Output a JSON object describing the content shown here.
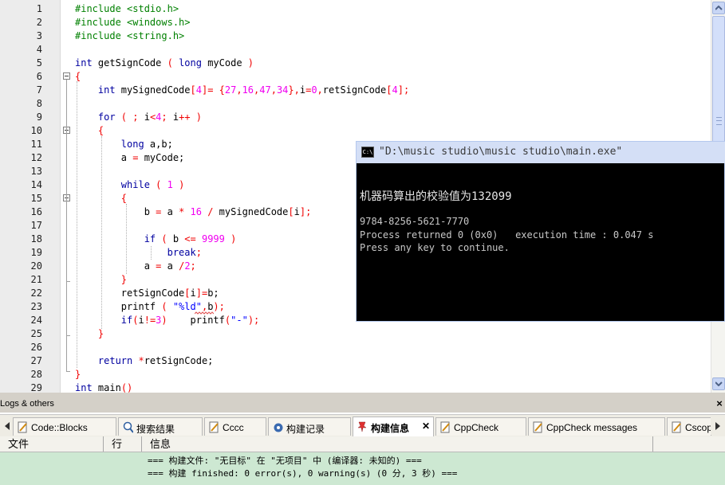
{
  "editor": {
    "line_numbers": [
      "1",
      "2",
      "3",
      "4",
      "5",
      "6",
      "7",
      "8",
      "9",
      "10",
      "11",
      "12",
      "13",
      "14",
      "15",
      "16",
      "17",
      "18",
      "19",
      "20",
      "21",
      "22",
      "23",
      "24",
      "25",
      "26",
      "27",
      "28",
      "29"
    ],
    "lines": [
      [
        {
          "t": "#include <stdio.h>",
          "c": "pp"
        }
      ],
      [
        {
          "t": "#include <windows.h>",
          "c": "pp"
        }
      ],
      [
        {
          "t": "#include <string.h>",
          "c": "pp"
        }
      ],
      [],
      [
        {
          "t": "int",
          "c": "kw"
        },
        {
          "t": " getSignCode ",
          "c": "id"
        },
        {
          "t": "(",
          "c": "op"
        },
        {
          "t": " long",
          "c": "kw"
        },
        {
          "t": " myCode ",
          "c": "id"
        },
        {
          "t": ")",
          "c": "op"
        }
      ],
      [
        {
          "t": "{",
          "c": "op"
        }
      ],
      [
        {
          "t": "    int",
          "c": "kw"
        },
        {
          "t": " mySignedCode",
          "c": "id"
        },
        {
          "t": "[",
          "c": "op"
        },
        {
          "t": "4",
          "c": "num"
        },
        {
          "t": "]= {",
          "c": "op"
        },
        {
          "t": "27",
          "c": "num"
        },
        {
          "t": ",",
          "c": "op"
        },
        {
          "t": "16",
          "c": "num"
        },
        {
          "t": ",",
          "c": "op"
        },
        {
          "t": "47",
          "c": "num"
        },
        {
          "t": ",",
          "c": "op"
        },
        {
          "t": "34",
          "c": "num"
        },
        {
          "t": "},",
          "c": "op"
        },
        {
          "t": "i",
          "c": "id"
        },
        {
          "t": "=",
          "c": "op"
        },
        {
          "t": "0",
          "c": "num"
        },
        {
          "t": ",",
          "c": "op"
        },
        {
          "t": "retSignCode",
          "c": "id"
        },
        {
          "t": "[",
          "c": "op"
        },
        {
          "t": "4",
          "c": "num"
        },
        {
          "t": "];",
          "c": "op"
        }
      ],
      [],
      [
        {
          "t": "    for",
          "c": "kw"
        },
        {
          "t": " ( ; ",
          "c": "op"
        },
        {
          "t": "i",
          "c": "id"
        },
        {
          "t": "<",
          "c": "op"
        },
        {
          "t": "4",
          "c": "num"
        },
        {
          "t": "; ",
          "c": "op"
        },
        {
          "t": "i",
          "c": "id"
        },
        {
          "t": "++ )",
          "c": "op"
        }
      ],
      [
        {
          "t": "    {",
          "c": "op"
        }
      ],
      [
        {
          "t": "        long",
          "c": "kw"
        },
        {
          "t": " a,b;",
          "c": "id"
        }
      ],
      [
        {
          "t": "        a ",
          "c": "id"
        },
        {
          "t": "=",
          "c": "op"
        },
        {
          "t": " myCode;",
          "c": "id"
        }
      ],
      [],
      [
        {
          "t": "        while",
          "c": "kw"
        },
        {
          "t": " ( ",
          "c": "op"
        },
        {
          "t": "1",
          "c": "num"
        },
        {
          "t": " )",
          "c": "op"
        }
      ],
      [
        {
          "t": "        {",
          "c": "op"
        }
      ],
      [
        {
          "t": "            b ",
          "c": "id"
        },
        {
          "t": "=",
          "c": "op"
        },
        {
          "t": " a ",
          "c": "id"
        },
        {
          "t": "*",
          "c": "op"
        },
        {
          "t": " 16 ",
          "c": "num"
        },
        {
          "t": "/",
          "c": "op"
        },
        {
          "t": " mySignedCode",
          "c": "id"
        },
        {
          "t": "[",
          "c": "op"
        },
        {
          "t": "i",
          "c": "id"
        },
        {
          "t": "];",
          "c": "op"
        }
      ],
      [],
      [
        {
          "t": "            if",
          "c": "kw"
        },
        {
          "t": " ( ",
          "c": "op"
        },
        {
          "t": "b ",
          "c": "id"
        },
        {
          "t": "<=",
          "c": "op"
        },
        {
          "t": " 9999",
          "c": "num"
        },
        {
          "t": " )",
          "c": "op"
        }
      ],
      [
        {
          "t": "                break",
          "c": "kw"
        },
        {
          "t": ";",
          "c": "op"
        }
      ],
      [
        {
          "t": "            a ",
          "c": "id"
        },
        {
          "t": "=",
          "c": "op"
        },
        {
          "t": " a ",
          "c": "id"
        },
        {
          "t": "/",
          "c": "op"
        },
        {
          "t": "2",
          "c": "num"
        },
        {
          "t": ";",
          "c": "op"
        }
      ],
      [
        {
          "t": "        }",
          "c": "op"
        }
      ],
      [
        {
          "t": "        retSignCode",
          "c": "id"
        },
        {
          "t": "[",
          "c": "op"
        },
        {
          "t": "i",
          "c": "id"
        },
        {
          "t": "]=",
          "c": "op"
        },
        {
          "t": "b;",
          "c": "id"
        }
      ],
      [
        {
          "t": "        printf ",
          "c": "id"
        },
        {
          "t": "( ",
          "c": "op"
        },
        {
          "t": "\"%ld\"",
          "c": "str"
        },
        {
          "t": ",",
          "c": "op"
        },
        {
          "t": "b",
          "c": "id"
        },
        {
          "t": ");",
          "c": "op"
        }
      ],
      [
        {
          "t": "        if",
          "c": "kw"
        },
        {
          "t": "(",
          "c": "op"
        },
        {
          "t": "i",
          "c": "id"
        },
        {
          "t": "!=",
          "c": "op"
        },
        {
          "t": "3",
          "c": "num"
        },
        {
          "t": ")    ",
          "c": "op"
        },
        {
          "t": "printf",
          "c": "id"
        },
        {
          "t": "(",
          "c": "op"
        },
        {
          "t": "\"-\"",
          "c": "str"
        },
        {
          "t": ");",
          "c": "op"
        }
      ],
      [
        {
          "t": "    }",
          "c": "op"
        }
      ],
      [],
      [
        {
          "t": "    return",
          "c": "kw"
        },
        {
          "t": " *",
          "c": "op"
        },
        {
          "t": "retSignCode;",
          "c": "id"
        }
      ],
      [
        {
          "t": "}",
          "c": "op"
        }
      ],
      [
        {
          "t": "int",
          "c": "kw"
        },
        {
          "t": " main",
          "c": "id"
        },
        {
          "t": "()",
          "c": "op"
        }
      ]
    ]
  },
  "console": {
    "icon_label": "C:\\",
    "title": "\"D:\\music studio\\music studio\\main.exe\"",
    "line1": "机器码算出的校验值为132099",
    "line2": "9784-8256-5621-7770",
    "line3": "Process returned 0 (0x0)   execution time : 0.047 s",
    "line4": "Press any key to continue."
  },
  "panel": {
    "title": "Logs & others",
    "close": "×",
    "tabs": [
      {
        "label": "Code::Blocks",
        "icon": "document-pencil-icon",
        "active": false
      },
      {
        "label": "搜索结果",
        "icon": "search-icon",
        "active": false
      },
      {
        "label": "Cccc",
        "icon": "document-pencil-icon",
        "active": false
      },
      {
        "label": "构建记录",
        "icon": "gear-icon",
        "active": false
      },
      {
        "label": "构建信息",
        "icon": "pin-icon",
        "active": true
      },
      {
        "label": "CppCheck",
        "icon": "document-pencil-icon",
        "active": false
      },
      {
        "label": "CppCheck messages",
        "icon": "document-pencil-icon",
        "active": false
      },
      {
        "label": "Cscop",
        "icon": "document-pencil-icon",
        "active": false
      }
    ],
    "columns": [
      "文件",
      "行",
      "信息"
    ],
    "messages": [
      "=== 构建文件: \"无目标\" 在 \"无项目\" 中 (编译器: 未知的) ===",
      "=== 构建 finished: 0 error(s), 0 warning(s) (0 分, 3 秒) ==="
    ]
  },
  "colors": {
    "preprocessor": "#008000",
    "keyword": "#0000a0",
    "number": "#f000f0",
    "operator": "#f00000",
    "string": "#0000ff",
    "list_background": "#cde8d2"
  }
}
